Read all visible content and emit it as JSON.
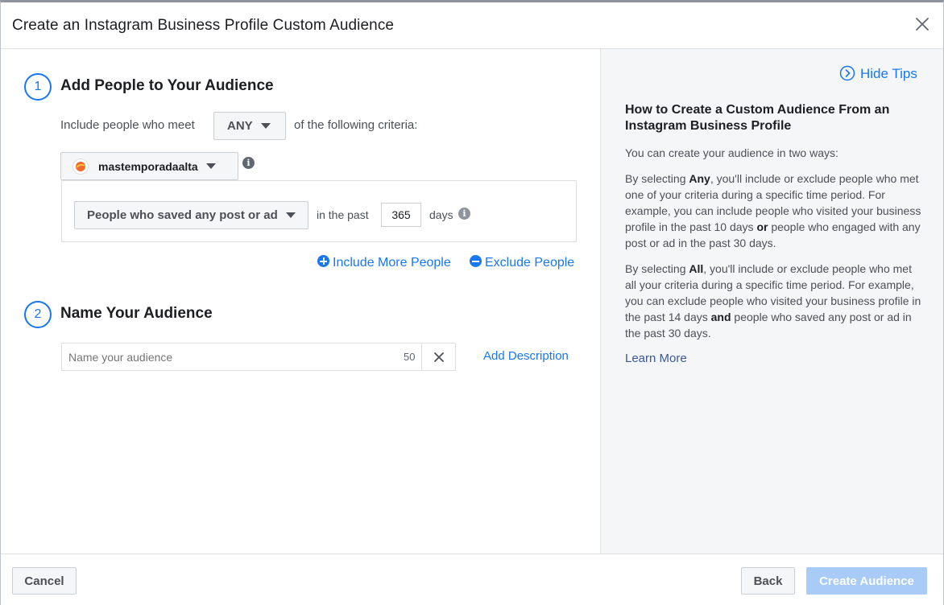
{
  "dialog": {
    "title": "Create an Instagram Business Profile Custom Audience"
  },
  "step1": {
    "number": "1",
    "title": "Add People to Your Audience",
    "include_prefix": "Include people who meet",
    "match_select": "ANY",
    "include_suffix": "of the following criteria:",
    "source_account": "mastemporadaalta",
    "event_select": "People who saved any post or ad",
    "in_the_past_label": "in the past",
    "days_value": "365",
    "days_label": "days",
    "include_more_link": "Include More People",
    "exclude_link": "Exclude People"
  },
  "step2": {
    "number": "2",
    "title": "Name Your Audience",
    "name_placeholder": "Name your audience",
    "char_count": "50",
    "add_description_link": "Add Description"
  },
  "tips": {
    "hide_tips_link": "Hide Tips",
    "heading": "How to Create a Custom Audience From an Instagram Business Profile",
    "intro": "You can create your audience in two ways:",
    "any_p1": "By selecting ",
    "any_bold": "Any",
    "any_p2": ", you'll include or exclude people who met one of your criteria during a specific time period. For example, you can include people who visited your business profile in the past 10 days ",
    "any_or": "or",
    "any_p3": " people who engaged with any post or ad in the past 30 days.",
    "all_p1": "By selecting ",
    "all_bold": "All",
    "all_p2": ", you'll include or exclude people who met all your criteria during a specific time period. For example, you can exclude people who visited your business profile in the past 14 days ",
    "all_and": "and",
    "all_p3": " people who saved any post or ad in the past 30 days.",
    "learn_more_link": "Learn More"
  },
  "footer": {
    "cancel_label": "Cancel",
    "back_label": "Back",
    "create_label": "Create Audience"
  },
  "colors": {
    "accent": "#1877f2",
    "create_disabled": "#a8cbf7"
  }
}
